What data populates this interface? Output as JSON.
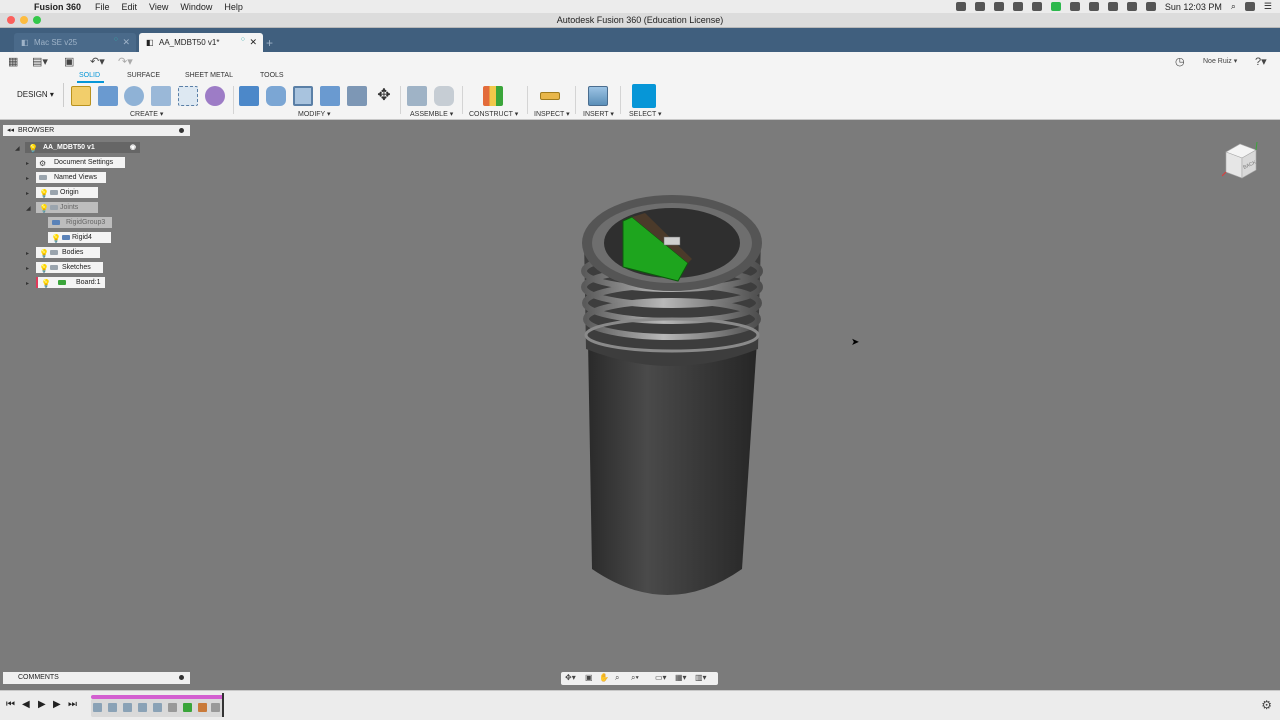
{
  "menubar": {
    "app_name": "Fusion 360",
    "items": [
      "File",
      "Edit",
      "View",
      "Window",
      "Help"
    ],
    "clock": "Sun 12:03 PM"
  },
  "window": {
    "title": "Autodesk Fusion 360 (Education License)"
  },
  "tabs": [
    {
      "label": "Mac SE v25",
      "active": false
    },
    {
      "label": "AA_MDBT50 v1*",
      "active": true
    }
  ],
  "user": {
    "name": "Noe Ruiz"
  },
  "workspace_tabs": [
    "SOLID",
    "SURFACE",
    "SHEET METAL",
    "TOOLS"
  ],
  "workspace_selected": "SOLID",
  "design_button": "DESIGN",
  "groups": {
    "create": "CREATE",
    "modify": "MODIFY",
    "assemble": "ASSEMBLE",
    "construct": "CONSTRUCT",
    "inspect": "INSPECT",
    "insert": "INSERT",
    "select": "SELECT"
  },
  "browser": {
    "title": "BROWSER",
    "root": "AA_MDBT50 v1",
    "nodes": [
      "Document Settings",
      "Named Views",
      "Origin",
      "Joints",
      "RigidGroup3",
      "Rigid4",
      "Bodies",
      "Sketches",
      "Board:1"
    ]
  },
  "viewcube": {
    "label": "BACK"
  },
  "comments_title": "COMMENTS",
  "colors": {
    "accent": "#0696d7",
    "tabbar": "#405f7e",
    "viewport": "#7b7b7b",
    "board": "#1ea51e",
    "timeline_track": "#d35fd0"
  }
}
